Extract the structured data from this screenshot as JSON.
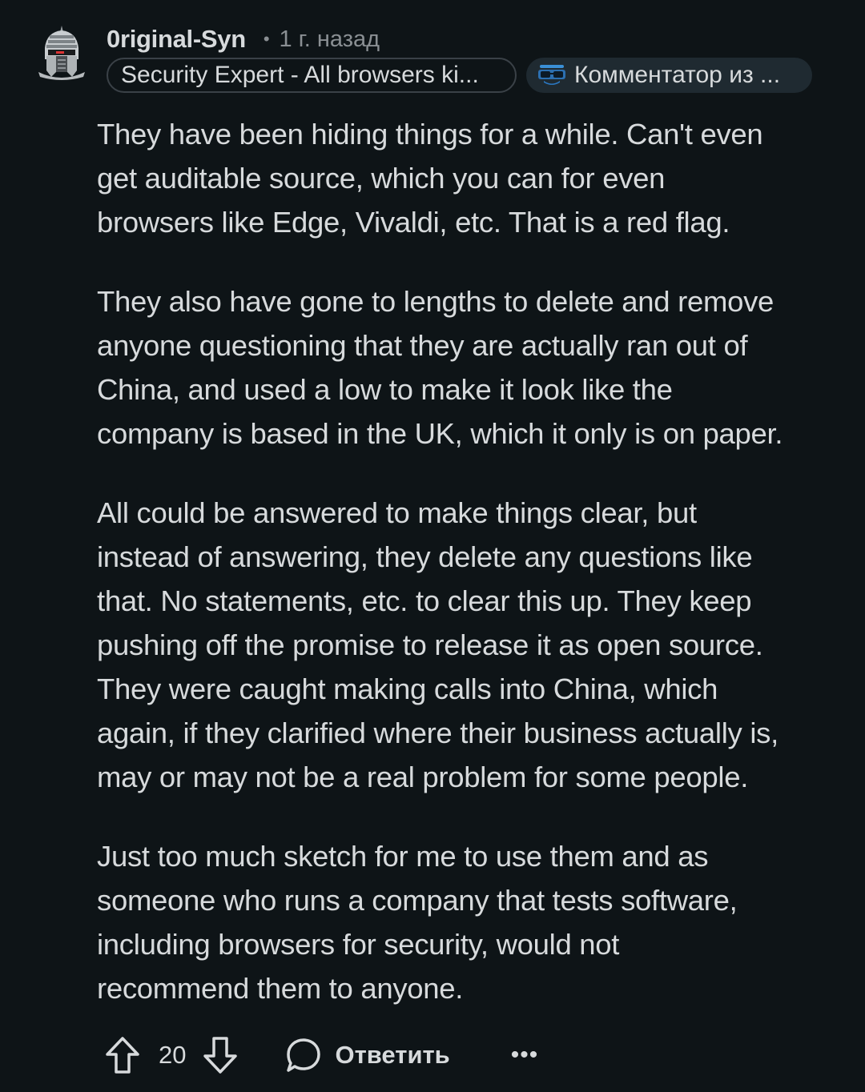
{
  "comment": {
    "author": "0riginal-Syn",
    "separator": "•",
    "time": "1 г. назад",
    "flairs": [
      {
        "text": "Security Expert - All browsers ki..."
      },
      {
        "text": "Комментатор из ...",
        "icon": "sunglasses-emoji-icon"
      }
    ],
    "paragraphs": [
      "They have been hiding things for a while. Can't even\nget auditable source, which you can for even\nbrowsers like Edge, Vivaldi, etc. That is a red flag.",
      "They also have gone to lengths to delete and remove\nanyone questioning that they are actually ran out of\nChina, and used a low to make it look like the\ncompany is based in the UK, which it only is on paper.",
      "All could be answered to make things clear, but\ninstead of answering, they delete any questions like\nthat. No statements, etc. to clear this up. They keep\npushing off the promise to release it as open source.\nThey were caught making calls into China, which\nagain, if they clarified where their business actually is,\nmay or may not be a real problem for some people.",
      "Just too much sketch for me to use them and as\nsomeone who runs a company that tests software,\nincluding browsers for security, would not\nrecommend them to anyone."
    ],
    "actions": {
      "score": "20",
      "reply_label": "Ответить",
      "more": "•••"
    }
  },
  "colors": {
    "background": "#0e1417",
    "text": "#d7dadc",
    "muted": "#8a8f93",
    "flair_border": "#3a4147",
    "flair_fill": "#1f2a31"
  }
}
